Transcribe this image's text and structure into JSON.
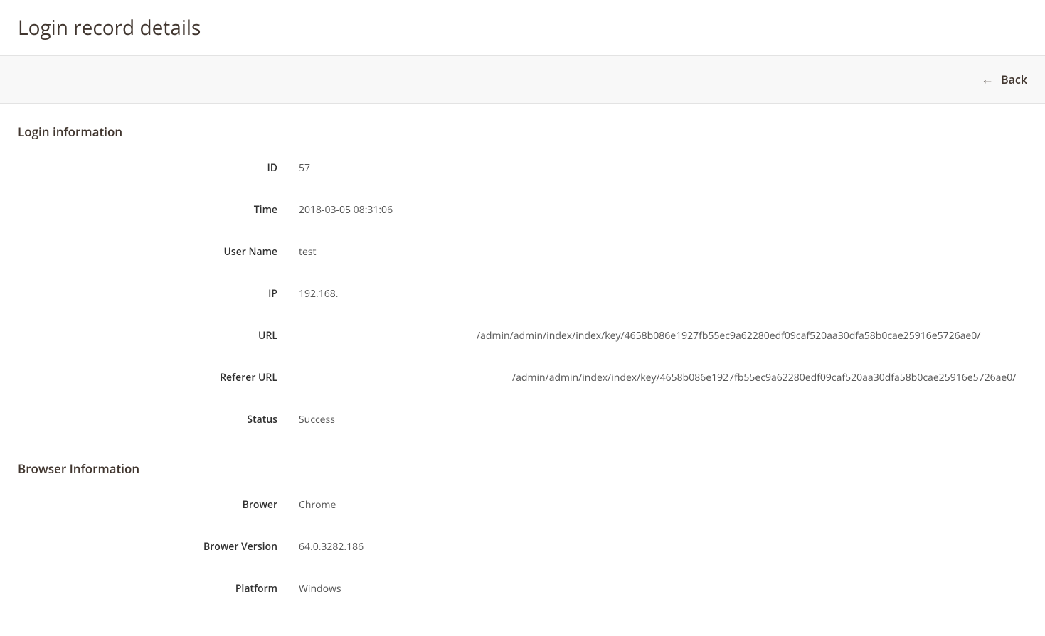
{
  "page": {
    "title": "Login record details",
    "back_label": "Back"
  },
  "sections": {
    "login_info": {
      "heading": "Login information",
      "fields": {
        "id": {
          "label": "ID",
          "value": "57"
        },
        "time": {
          "label": "Time",
          "value": "2018-03-05 08:31:06"
        },
        "user_name": {
          "label": "User Name",
          "value": "test"
        },
        "ip": {
          "label": "IP",
          "value": "192.168."
        },
        "url": {
          "label": "URL",
          "value": "/admin/admin/index/index/key/4658b086e1927fb55ec9a62280edf09caf520aa30dfa58b0cae25916e5726ae0/"
        },
        "referer_url": {
          "label": "Referer URL",
          "value": "/admin/admin/index/index/key/4658b086e1927fb55ec9a62280edf09caf520aa30dfa58b0cae25916e5726ae0/"
        },
        "status": {
          "label": "Status",
          "value": "Success"
        }
      }
    },
    "browser_info": {
      "heading": "Browser Information",
      "fields": {
        "browser": {
          "label": "Brower",
          "value": "Chrome"
        },
        "browser_version": {
          "label": "Brower Version",
          "value": "64.0.3282.186"
        },
        "platform": {
          "label": "Platform",
          "value": "Windows"
        }
      }
    }
  }
}
